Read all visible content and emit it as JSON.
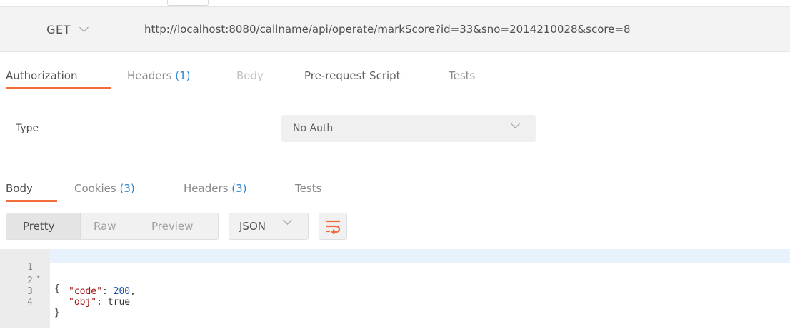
{
  "request": {
    "method": "GET",
    "url": "http://localhost:8080/callname/api/operate/markScore?id=33&sno=2014210028&score=8"
  },
  "request_tabs": [
    {
      "label": "Authorization",
      "count": ""
    },
    {
      "label": "Headers",
      "count": "(1)"
    },
    {
      "label": "Body",
      "count": ""
    },
    {
      "label": "Pre-request Script",
      "count": ""
    },
    {
      "label": "Tests",
      "count": ""
    }
  ],
  "auth": {
    "type_label": "Type",
    "type_value": "No Auth"
  },
  "response_tabs": [
    {
      "label": "Body",
      "count": ""
    },
    {
      "label": "Cookies",
      "count": "(3)"
    },
    {
      "label": "Headers",
      "count": "(3)"
    },
    {
      "label": "Tests",
      "count": ""
    }
  ],
  "view_modes": [
    "Pretty",
    "Raw",
    "Preview"
  ],
  "format": "JSON",
  "icons": {
    "method_dropdown": "chevron-down-icon",
    "auth_dropdown": "chevron-down-icon",
    "format_dropdown": "chevron-down-icon",
    "wrap": "wrap-lines-icon",
    "fold": "fold-arrow-icon"
  },
  "colors": {
    "accent": "#f26b3a",
    "count": "#2f87ce",
    "json_key": "#a31515",
    "json_number": "#1a4fb0"
  },
  "response_code": {
    "line_numbers": [
      "1",
      "2",
      "3",
      "4"
    ],
    "open_brace": "{",
    "code_key": "\"code\"",
    "code_sep": ": ",
    "code_value": "200",
    "code_comma": ",",
    "obj_key": "\"obj\"",
    "obj_sep": ": ",
    "obj_value": "true",
    "close_brace": "}"
  }
}
